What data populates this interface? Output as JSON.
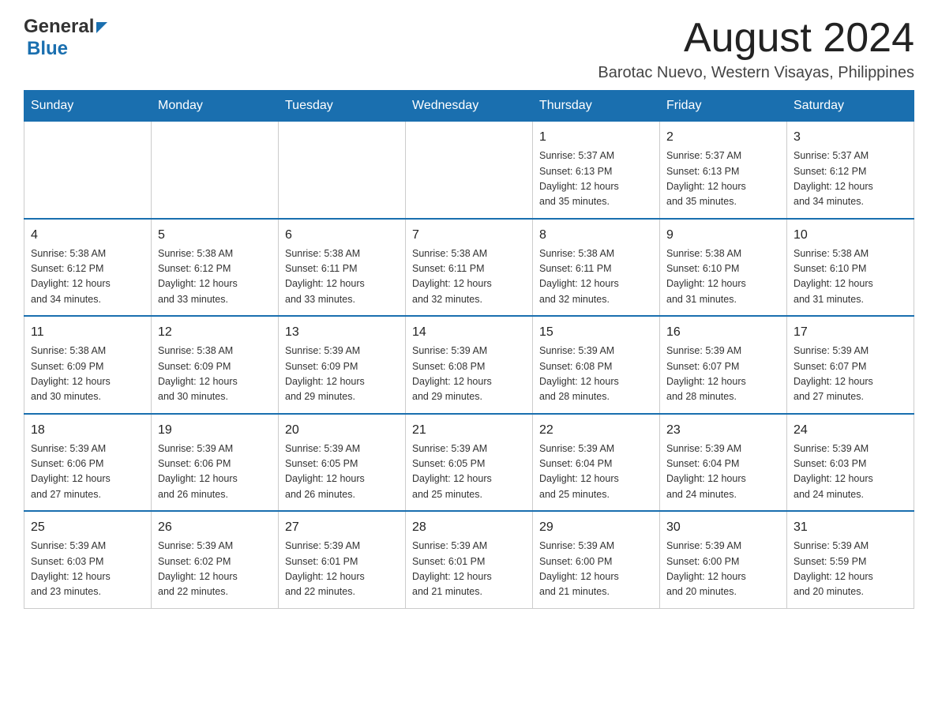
{
  "header": {
    "logo_general": "General",
    "logo_blue": "Blue",
    "month_year": "August 2024",
    "location": "Barotac Nuevo, Western Visayas, Philippines"
  },
  "days_of_week": [
    "Sunday",
    "Monday",
    "Tuesday",
    "Wednesday",
    "Thursday",
    "Friday",
    "Saturday"
  ],
  "weeks": [
    [
      {
        "day": "",
        "info": ""
      },
      {
        "day": "",
        "info": ""
      },
      {
        "day": "",
        "info": ""
      },
      {
        "day": "",
        "info": ""
      },
      {
        "day": "1",
        "info": "Sunrise: 5:37 AM\nSunset: 6:13 PM\nDaylight: 12 hours\nand 35 minutes."
      },
      {
        "day": "2",
        "info": "Sunrise: 5:37 AM\nSunset: 6:13 PM\nDaylight: 12 hours\nand 35 minutes."
      },
      {
        "day": "3",
        "info": "Sunrise: 5:37 AM\nSunset: 6:12 PM\nDaylight: 12 hours\nand 34 minutes."
      }
    ],
    [
      {
        "day": "4",
        "info": "Sunrise: 5:38 AM\nSunset: 6:12 PM\nDaylight: 12 hours\nand 34 minutes."
      },
      {
        "day": "5",
        "info": "Sunrise: 5:38 AM\nSunset: 6:12 PM\nDaylight: 12 hours\nand 33 minutes."
      },
      {
        "day": "6",
        "info": "Sunrise: 5:38 AM\nSunset: 6:11 PM\nDaylight: 12 hours\nand 33 minutes."
      },
      {
        "day": "7",
        "info": "Sunrise: 5:38 AM\nSunset: 6:11 PM\nDaylight: 12 hours\nand 32 minutes."
      },
      {
        "day": "8",
        "info": "Sunrise: 5:38 AM\nSunset: 6:11 PM\nDaylight: 12 hours\nand 32 minutes."
      },
      {
        "day": "9",
        "info": "Sunrise: 5:38 AM\nSunset: 6:10 PM\nDaylight: 12 hours\nand 31 minutes."
      },
      {
        "day": "10",
        "info": "Sunrise: 5:38 AM\nSunset: 6:10 PM\nDaylight: 12 hours\nand 31 minutes."
      }
    ],
    [
      {
        "day": "11",
        "info": "Sunrise: 5:38 AM\nSunset: 6:09 PM\nDaylight: 12 hours\nand 30 minutes."
      },
      {
        "day": "12",
        "info": "Sunrise: 5:38 AM\nSunset: 6:09 PM\nDaylight: 12 hours\nand 30 minutes."
      },
      {
        "day": "13",
        "info": "Sunrise: 5:39 AM\nSunset: 6:09 PM\nDaylight: 12 hours\nand 29 minutes."
      },
      {
        "day": "14",
        "info": "Sunrise: 5:39 AM\nSunset: 6:08 PM\nDaylight: 12 hours\nand 29 minutes."
      },
      {
        "day": "15",
        "info": "Sunrise: 5:39 AM\nSunset: 6:08 PM\nDaylight: 12 hours\nand 28 minutes."
      },
      {
        "day": "16",
        "info": "Sunrise: 5:39 AM\nSunset: 6:07 PM\nDaylight: 12 hours\nand 28 minutes."
      },
      {
        "day": "17",
        "info": "Sunrise: 5:39 AM\nSunset: 6:07 PM\nDaylight: 12 hours\nand 27 minutes."
      }
    ],
    [
      {
        "day": "18",
        "info": "Sunrise: 5:39 AM\nSunset: 6:06 PM\nDaylight: 12 hours\nand 27 minutes."
      },
      {
        "day": "19",
        "info": "Sunrise: 5:39 AM\nSunset: 6:06 PM\nDaylight: 12 hours\nand 26 minutes."
      },
      {
        "day": "20",
        "info": "Sunrise: 5:39 AM\nSunset: 6:05 PM\nDaylight: 12 hours\nand 26 minutes."
      },
      {
        "day": "21",
        "info": "Sunrise: 5:39 AM\nSunset: 6:05 PM\nDaylight: 12 hours\nand 25 minutes."
      },
      {
        "day": "22",
        "info": "Sunrise: 5:39 AM\nSunset: 6:04 PM\nDaylight: 12 hours\nand 25 minutes."
      },
      {
        "day": "23",
        "info": "Sunrise: 5:39 AM\nSunset: 6:04 PM\nDaylight: 12 hours\nand 24 minutes."
      },
      {
        "day": "24",
        "info": "Sunrise: 5:39 AM\nSunset: 6:03 PM\nDaylight: 12 hours\nand 24 minutes."
      }
    ],
    [
      {
        "day": "25",
        "info": "Sunrise: 5:39 AM\nSunset: 6:03 PM\nDaylight: 12 hours\nand 23 minutes."
      },
      {
        "day": "26",
        "info": "Sunrise: 5:39 AM\nSunset: 6:02 PM\nDaylight: 12 hours\nand 22 minutes."
      },
      {
        "day": "27",
        "info": "Sunrise: 5:39 AM\nSunset: 6:01 PM\nDaylight: 12 hours\nand 22 minutes."
      },
      {
        "day": "28",
        "info": "Sunrise: 5:39 AM\nSunset: 6:01 PM\nDaylight: 12 hours\nand 21 minutes."
      },
      {
        "day": "29",
        "info": "Sunrise: 5:39 AM\nSunset: 6:00 PM\nDaylight: 12 hours\nand 21 minutes."
      },
      {
        "day": "30",
        "info": "Sunrise: 5:39 AM\nSunset: 6:00 PM\nDaylight: 12 hours\nand 20 minutes."
      },
      {
        "day": "31",
        "info": "Sunrise: 5:39 AM\nSunset: 5:59 PM\nDaylight: 12 hours\nand 20 minutes."
      }
    ]
  ]
}
